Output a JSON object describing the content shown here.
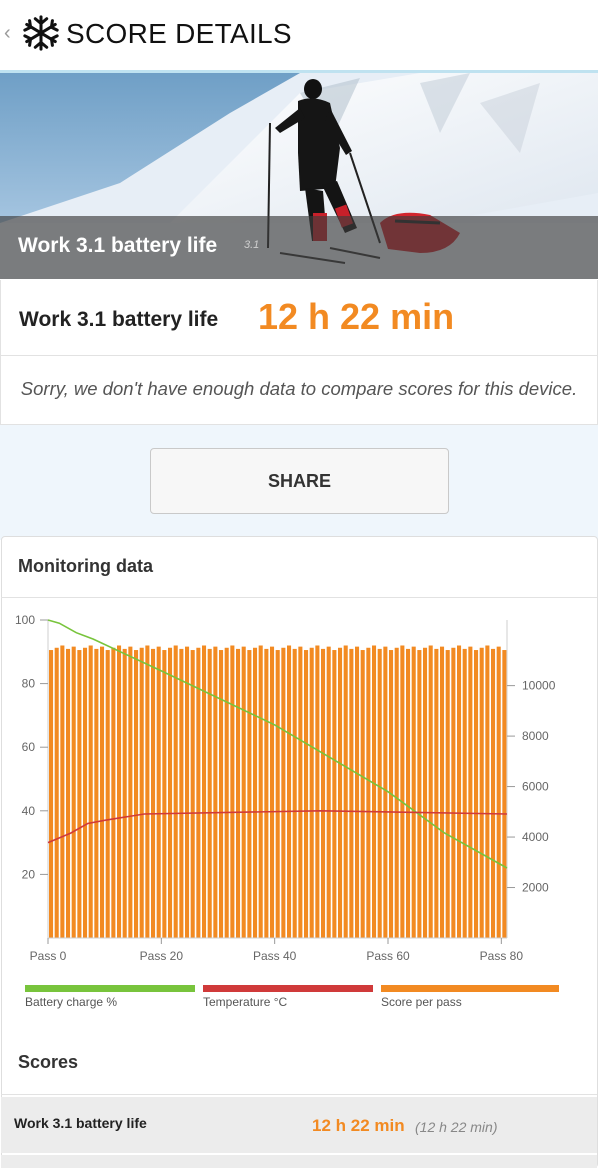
{
  "header": {
    "back_glyph": "‹",
    "title": "SCORE DETAILS",
    "logo_icon": "snowflake-icon"
  },
  "hero": {
    "title": "Work 3.1 battery life",
    "version": "3.1"
  },
  "result": {
    "label": "Work 3.1 battery life",
    "value": "12 h 22 min"
  },
  "notice": "Sorry, we don't have enough data to compare scores for this device.",
  "share_label": "SHARE",
  "monitoring": {
    "title": "Monitoring data",
    "legend": [
      {
        "label": "Battery charge %",
        "color": "#78c43c"
      },
      {
        "label": "Temperature °C",
        "color": "#d03a3a"
      },
      {
        "label": "Score per pass",
        "color": "#f28a22"
      }
    ]
  },
  "chart_data": {
    "type": "bar",
    "x_ticks": [
      "Pass 0",
      "Pass 20",
      "Pass 40",
      "Pass 60",
      "Pass 80"
    ],
    "x_range": [
      0,
      81
    ],
    "left_axis": {
      "ticks": [
        "100",
        "80",
        "60",
        "40",
        "20"
      ],
      "range": [
        0,
        100
      ]
    },
    "right_axis": {
      "ticks": [
        "10000",
        "8000",
        "6000",
        "4000",
        "2000"
      ],
      "range": [
        0,
        12600
      ]
    },
    "series": [
      {
        "name": "Score per pass",
        "axis": "right",
        "type": "bar",
        "value_typical": 11500,
        "count": 81
      },
      {
        "name": "Battery charge %",
        "axis": "left",
        "type": "line",
        "x": [
          0,
          2,
          5,
          8,
          20,
          40,
          60,
          70,
          81
        ],
        "y": [
          100,
          99,
          96,
          94,
          84,
          67,
          46,
          33,
          22
        ]
      },
      {
        "name": "Temperature °C",
        "axis": "left",
        "type": "line",
        "x": [
          0,
          4,
          7,
          10,
          17,
          48,
          81
        ],
        "y": [
          30,
          33,
          36,
          37,
          39,
          40,
          39
        ]
      }
    ]
  },
  "scores": {
    "title": "Scores",
    "rows": [
      {
        "name": "Work 3.1 battery life",
        "value": "12 h 22 min",
        "sub": "(12 h 22 min)"
      }
    ]
  }
}
